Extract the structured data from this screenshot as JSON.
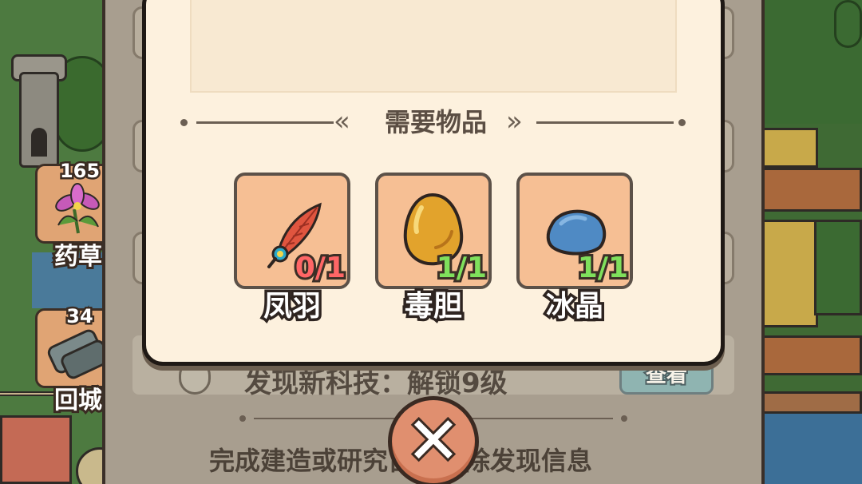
{
  "left_sidebar": {
    "resources": [
      {
        "count": "165",
        "label": "药草"
      },
      {
        "count": "34",
        "label": "回城"
      }
    ]
  },
  "background_panel": {
    "discover_text": "发现新科技：解锁9级",
    "view_button": "查看",
    "footer_text": "完成建造或研究自动移除发现信息"
  },
  "popup": {
    "section_title": "需要物品",
    "items": [
      {
        "name": "凤羽",
        "count": "0/1",
        "sufficient": false,
        "icon": "phoenix-feather-icon"
      },
      {
        "name": "毒胆",
        "count": "1/1",
        "sufficient": true,
        "icon": "poison-gall-icon"
      },
      {
        "name": "冰晶",
        "count": "1/1",
        "sufficient": true,
        "icon": "ice-crystal-icon"
      }
    ],
    "close_icon": "close-icon"
  },
  "colors": {
    "popup_bg": "#fdf1de",
    "item_bg": "#f6bf94",
    "insufficient": "#ff6666",
    "sufficient": "#7fe05c",
    "close_button": "#e08f6f"
  }
}
